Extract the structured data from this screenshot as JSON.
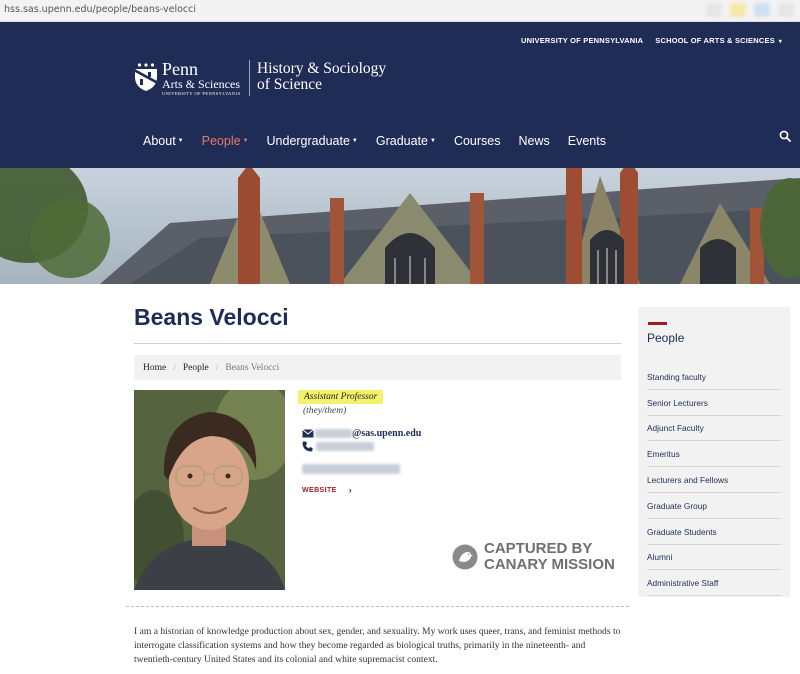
{
  "browser": {
    "url": "hss.sas.upenn.edu/people/beans-velocci"
  },
  "header": {
    "top_links": [
      "UNIVERSITY OF PENNSYLVANIA",
      "SCHOOL OF ARTS & SCIENCES"
    ],
    "logo": {
      "line1": "Penn",
      "line2": "Arts & Sciences",
      "line3": "UNIVERSITY OF PENNSYLVANIA"
    },
    "department": {
      "line1": "History & Sociology",
      "line2": "of Science"
    },
    "nav": [
      {
        "label": "About",
        "dropdown": true
      },
      {
        "label": "People",
        "dropdown": true,
        "active": true
      },
      {
        "label": "Undergraduate",
        "dropdown": true
      },
      {
        "label": "Graduate",
        "dropdown": true
      },
      {
        "label": "Courses"
      },
      {
        "label": "News"
      },
      {
        "label": "Events"
      }
    ],
    "search_icon": "search-icon"
  },
  "profile": {
    "name": "Beans Velocci",
    "breadcrumb": [
      "Home",
      "People",
      "Beans Velocci"
    ],
    "title": "Assistant Professor",
    "pronouns": "(they/them)",
    "email_domain": "@sas.upenn.edu",
    "website_label": "WEBSITE",
    "bio": "I am a historian of knowledge production about sex, gender, and sexuality. My work uses queer, trans, and feminist methods to interrogate classification systems and how they become regarded as biological truths, primarily in the nineteenth- and twentieth-century United States and its colonial and white supremacist context."
  },
  "watermark": {
    "line1": "CAPTURED BY",
    "line2": "CANARY MISSION"
  },
  "sidebar": {
    "title": "People",
    "items": [
      "Standing faculty",
      "Senior Lecturers",
      "Adjunct Faculty",
      "Emeritus",
      "Lecturers and Fellows",
      "Graduate Group",
      "Graduate Students",
      "Alumni",
      "Administrative Staff"
    ]
  },
  "colors": {
    "navy": "#1f2c56",
    "accent_red": "#a11a22",
    "active_nav": "#e4776e",
    "highlight": "#f2f36a"
  }
}
